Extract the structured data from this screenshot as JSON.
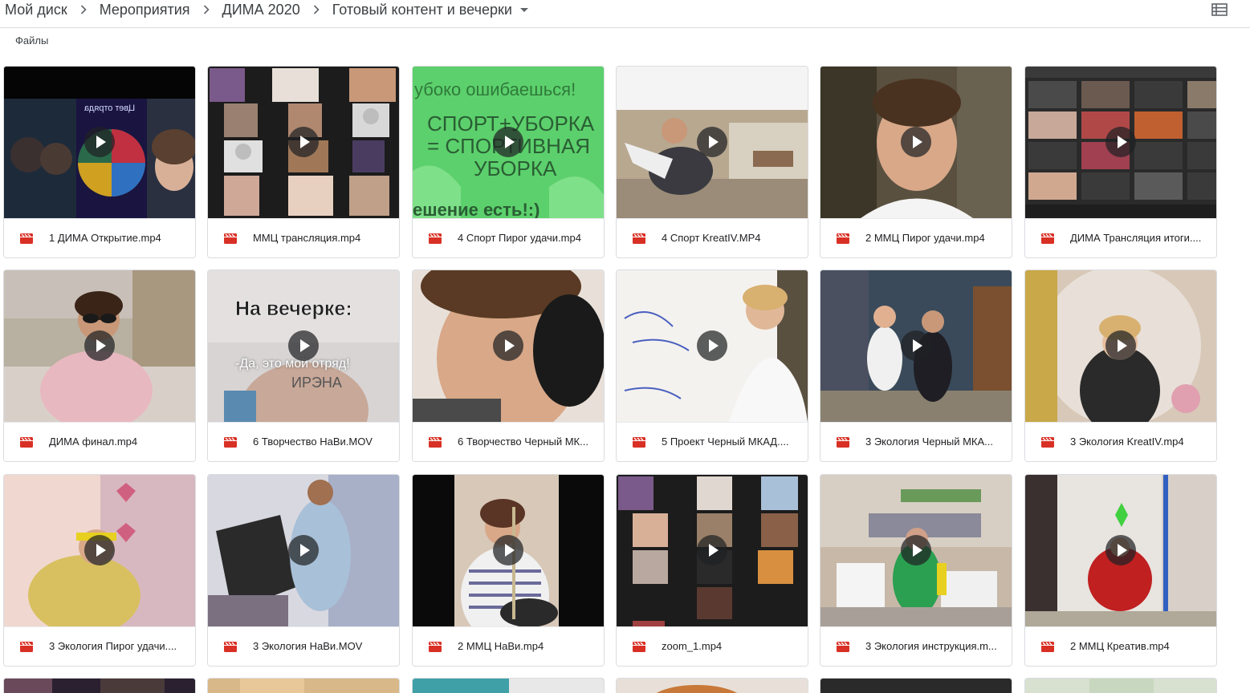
{
  "breadcrumb": {
    "items": [
      "Мой диск",
      "Мероприятия",
      "ДИМА 2020",
      "Готовый контент и вечерки"
    ]
  },
  "section": {
    "files_label": "Файлы"
  },
  "colors": {
    "video_icon": "#d93025",
    "play_overlay": "#202124",
    "border": "#dadce0"
  },
  "thumb_texts": {
    "sport_line1": "убоко ошибаешься!",
    "sport_line2": "СПОРТ+УБОРКА",
    "sport_line3": "= СПОРТИВНАЯ",
    "sport_line4": "УБОРКА",
    "sport_line5": "ешение есть!:)",
    "vecherka_title": "На вечерке:",
    "vecherka_sub": "-Да, это мой отряд!",
    "vecherka_name": "ИРЭНА",
    "wheel_title": "Цвет отряда"
  },
  "files": [
    {
      "name": "1 ДИМА Открытие.mp4"
    },
    {
      "name": "ММЦ трансляция.mp4"
    },
    {
      "name": "4 Спорт Пирог удачи.mp4"
    },
    {
      "name": "4 Спорт KreatIV.MP4"
    },
    {
      "name": "2 ММЦ Пирог удачи.mp4"
    },
    {
      "name": "ДИМА Трансляция итоги...."
    },
    {
      "name": "ДИМА финал.mp4"
    },
    {
      "name": "6 Творчество НаВи.MOV"
    },
    {
      "name": "6 Творчество Черный МК..."
    },
    {
      "name": "5 Проект Черный МКАД...."
    },
    {
      "name": "3 Экология Черный МКА..."
    },
    {
      "name": "3 Экология KreatIV.mp4"
    },
    {
      "name": "3 Экология Пирог удачи...."
    },
    {
      "name": "3 Экология НаВи.MOV"
    },
    {
      "name": "2 ММЦ НаВи.mp4"
    },
    {
      "name": "zoom_1.mp4"
    },
    {
      "name": "3 Экология инструкция.m..."
    },
    {
      "name": "2 ММЦ Креатив.mp4"
    }
  ]
}
